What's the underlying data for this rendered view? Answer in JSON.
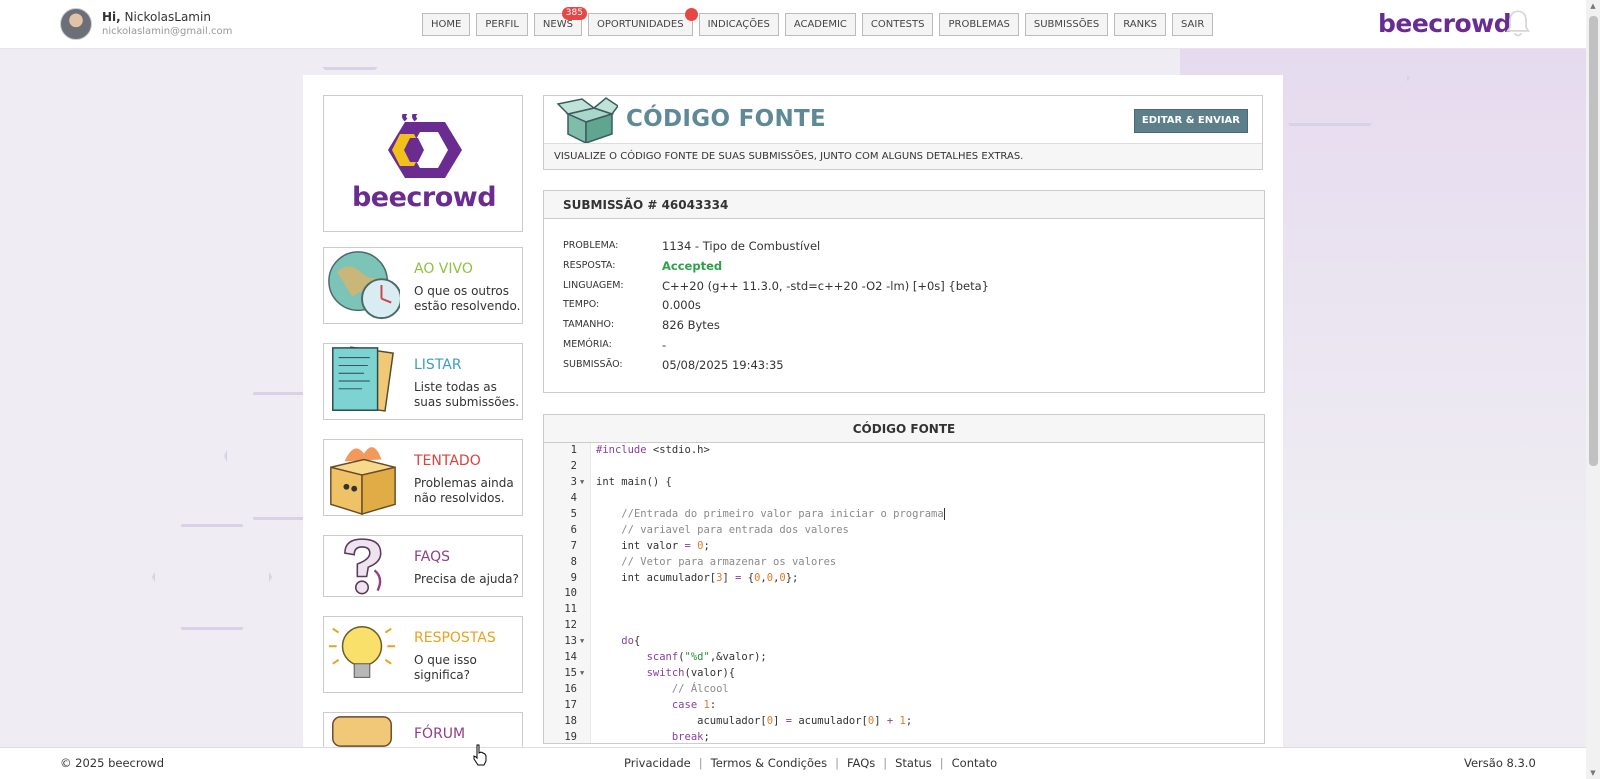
{
  "user": {
    "greeting_prefix": "Hi,",
    "name": "NickolasLamin",
    "email": "nickolaslamin@gmail.com"
  },
  "nav": {
    "items": [
      {
        "label": "HOME"
      },
      {
        "label": "PERFIL"
      },
      {
        "label": "NEWS",
        "badge": "385"
      },
      {
        "label": "OPORTUNIDADES",
        "dot": true
      },
      {
        "label": "INDICAÇÕES"
      },
      {
        "label": "ACADEMIC"
      },
      {
        "label": "CONTESTS"
      },
      {
        "label": "PROBLEMAS"
      },
      {
        "label": "SUBMISSÕES"
      },
      {
        "label": "RANKS"
      },
      {
        "label": "SAIR"
      }
    ]
  },
  "brand": {
    "name": "beecrowd",
    "color": "#6a2c91"
  },
  "sidebar": {
    "cards": [
      {
        "title": "AO VIVO",
        "desc": "O que os outros estão resolvendo.",
        "color": "#8cc33f",
        "icon": "globe-clock-icon"
      },
      {
        "title": "LISTAR",
        "desc": "Liste todas as suas submissões.",
        "color": "#3aa0bf",
        "icon": "papers-icon"
      },
      {
        "title": "TENTADO",
        "desc": "Problemas ainda não resolvidos.",
        "color": "#e0403a",
        "icon": "burning-box-icon"
      },
      {
        "title": "FAQS",
        "desc": "Precisa de ajuda?",
        "color": "#8e3f85",
        "icon": "question-mark-icon"
      },
      {
        "title": "RESPOSTAS",
        "desc": "O que isso significa?",
        "color": "#e9a21d",
        "icon": "lightbulb-icon"
      },
      {
        "title": "FÓRUM",
        "desc": "",
        "color": "#8e3f85",
        "icon": "forum-icon"
      }
    ]
  },
  "header": {
    "title": "CÓDIGO FONTE",
    "edit_button": "EDITAR & ENVIAR",
    "subtitle": "VISUALIZE O CÓDIGO FONTE DE SUAS SUBMISSÕES, JUNTO COM ALGUNS DETALHES EXTRAS."
  },
  "submission": {
    "heading": "SUBMISSÃO # 46043334",
    "rows": [
      {
        "key": "PROBLEMA:",
        "value": "1134 - Tipo de Combustível"
      },
      {
        "key": "RESPOSTA:",
        "value": "Accepted",
        "status_color": "#2ba346"
      },
      {
        "key": "LINGUAGEM:",
        "value": "C++20 (g++ 11.3.0, -std=c++20 -O2 -lm) [+0s] {beta}"
      },
      {
        "key": "TEMPO:",
        "value": "0.000s"
      },
      {
        "key": "TAMANHO:",
        "value": "826 Bytes"
      },
      {
        "key": "MEMÓRIA:",
        "value": "-"
      },
      {
        "key": "SUBMISSÃO:",
        "value": "05/08/2025 19:43:35"
      }
    ]
  },
  "code": {
    "heading": "CÓDIGO FONTE",
    "lines": [
      {
        "n": "1",
        "fold": false,
        "tokens": [
          [
            "k",
            "#include"
          ],
          [
            "p",
            " <stdio.h>"
          ]
        ]
      },
      {
        "n": "2",
        "fold": false,
        "tokens": []
      },
      {
        "n": "3",
        "fold": true,
        "tokens": [
          [
            "p",
            "int main() {"
          ]
        ]
      },
      {
        "n": "4",
        "fold": false,
        "tokens": []
      },
      {
        "n": "5",
        "fold": false,
        "tokens": [
          [
            "p",
            "    "
          ],
          [
            "c",
            "//Entrada do primeiro valor para iniciar o programa"
          ]
        ],
        "cursor": true
      },
      {
        "n": "6",
        "fold": false,
        "tokens": [
          [
            "p",
            "    "
          ],
          [
            "c",
            "// variavel para entrada dos valores"
          ]
        ]
      },
      {
        "n": "7",
        "fold": false,
        "tokens": [
          [
            "p",
            "    int valor "
          ],
          [
            "k",
            "="
          ],
          [
            "p",
            " "
          ],
          [
            "n",
            "0"
          ],
          [
            "p",
            ";"
          ]
        ]
      },
      {
        "n": "8",
        "fold": false,
        "tokens": [
          [
            "p",
            "    "
          ],
          [
            "c",
            "// Vetor para armazenar os valores"
          ]
        ]
      },
      {
        "n": "9",
        "fold": false,
        "tokens": [
          [
            "p",
            "    int acumulador["
          ],
          [
            "n",
            "3"
          ],
          [
            "p",
            "] "
          ],
          [
            "k",
            "="
          ],
          [
            "p",
            " {"
          ],
          [
            "n",
            "0"
          ],
          [
            "p",
            ","
          ],
          [
            "n",
            "0"
          ],
          [
            "p",
            ","
          ],
          [
            "n",
            "0"
          ],
          [
            "p",
            "};"
          ]
        ]
      },
      {
        "n": "10",
        "fold": false,
        "tokens": []
      },
      {
        "n": "11",
        "fold": false,
        "tokens": []
      },
      {
        "n": "12",
        "fold": false,
        "tokens": []
      },
      {
        "n": "13",
        "fold": true,
        "tokens": [
          [
            "p",
            "    "
          ],
          [
            "k",
            "do"
          ],
          [
            "p",
            "{"
          ]
        ]
      },
      {
        "n": "14",
        "fold": false,
        "tokens": [
          [
            "p",
            "        "
          ],
          [
            "k",
            "scanf"
          ],
          [
            "p",
            "("
          ],
          [
            "s",
            "\"%d\""
          ],
          [
            "p",
            ",&valor);"
          ]
        ]
      },
      {
        "n": "15",
        "fold": true,
        "tokens": [
          [
            "p",
            "        "
          ],
          [
            "k",
            "switch"
          ],
          [
            "p",
            "(valor){"
          ]
        ]
      },
      {
        "n": "16",
        "fold": false,
        "tokens": [
          [
            "p",
            "            "
          ],
          [
            "c",
            "// Álcool"
          ]
        ]
      },
      {
        "n": "17",
        "fold": false,
        "tokens": [
          [
            "p",
            "            "
          ],
          [
            "k",
            "case"
          ],
          [
            "p",
            " "
          ],
          [
            "n",
            "1"
          ],
          [
            "p",
            ":"
          ]
        ]
      },
      {
        "n": "18",
        "fold": false,
        "tokens": [
          [
            "p",
            "                acumulador["
          ],
          [
            "n",
            "0"
          ],
          [
            "p",
            "] "
          ],
          [
            "k",
            "="
          ],
          [
            "p",
            " acumulador["
          ],
          [
            "n",
            "0"
          ],
          [
            "p",
            "] "
          ],
          [
            "k",
            "+"
          ],
          [
            "p",
            " "
          ],
          [
            "n",
            "1"
          ],
          [
            "p",
            ";"
          ]
        ]
      },
      {
        "n": "19",
        "fold": false,
        "tokens": [
          [
            "p",
            "            "
          ],
          [
            "k",
            "break"
          ],
          [
            "p",
            ";"
          ]
        ]
      }
    ]
  },
  "footer": {
    "copyright": "© 2025 beecrowd",
    "links": [
      "Privacidade",
      "Termos & Condições",
      "FAQs",
      "Status",
      "Contato"
    ],
    "version": "Versão 8.3.0"
  }
}
